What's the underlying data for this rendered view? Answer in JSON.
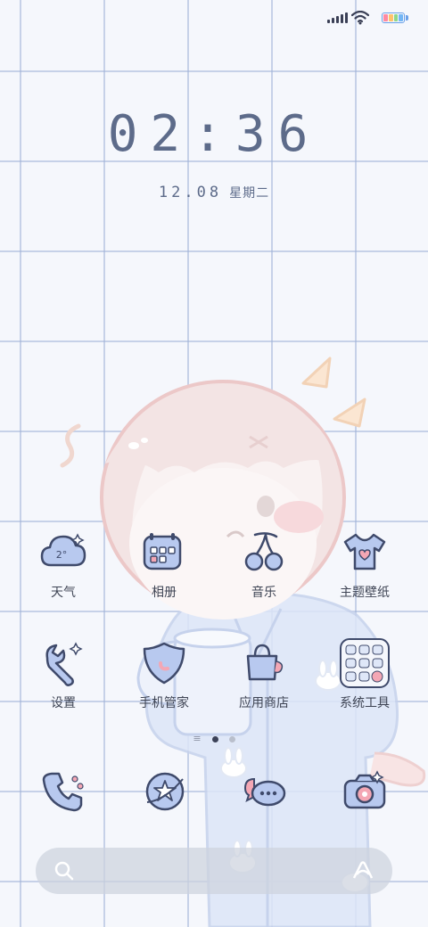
{
  "status_bar": {
    "signal_icon": "signal-bars-icon",
    "wifi_icon": "wifi-icon",
    "battery_icon": "battery-icon",
    "battery_colors": [
      "#ff8aa2",
      "#ffc36b",
      "#8fd78a",
      "#74b6f5"
    ]
  },
  "lock": {
    "time": "02:36",
    "date": "12.08",
    "weekday": "星期二"
  },
  "apps": [
    {
      "label": "天气",
      "icon": "weather-cloud-icon",
      "temp": "2°"
    },
    {
      "label": "相册",
      "icon": "gallery-icon"
    },
    {
      "label": "音乐",
      "icon": "music-cherry-icon"
    },
    {
      "label": "主题壁纸",
      "icon": "theme-shirt-icon"
    },
    {
      "label": "设置",
      "icon": "settings-wrench-icon"
    },
    {
      "label": "手机管家",
      "icon": "security-shield-icon"
    },
    {
      "label": "应用商店",
      "icon": "app-store-bag-icon"
    },
    {
      "label": "系统工具",
      "icon": "system-tools-folder-icon"
    }
  ],
  "page_indicator": {
    "pages": 2,
    "active": 1
  },
  "dock": [
    {
      "icon": "phone-icon"
    },
    {
      "icon": "browser-star-icon"
    },
    {
      "icon": "messages-icon"
    },
    {
      "icon": "camera-icon"
    }
  ],
  "search_bar": {
    "search_icon": "search-icon",
    "assistant_icon": "assistant-icon"
  },
  "colors": {
    "icon_outline": "#3f4a6b",
    "icon_fill": "#b8c9ef",
    "accent_pink": "#f4a7b4",
    "grid_line": "#a0b2d7",
    "text": "#5d6b8a"
  }
}
